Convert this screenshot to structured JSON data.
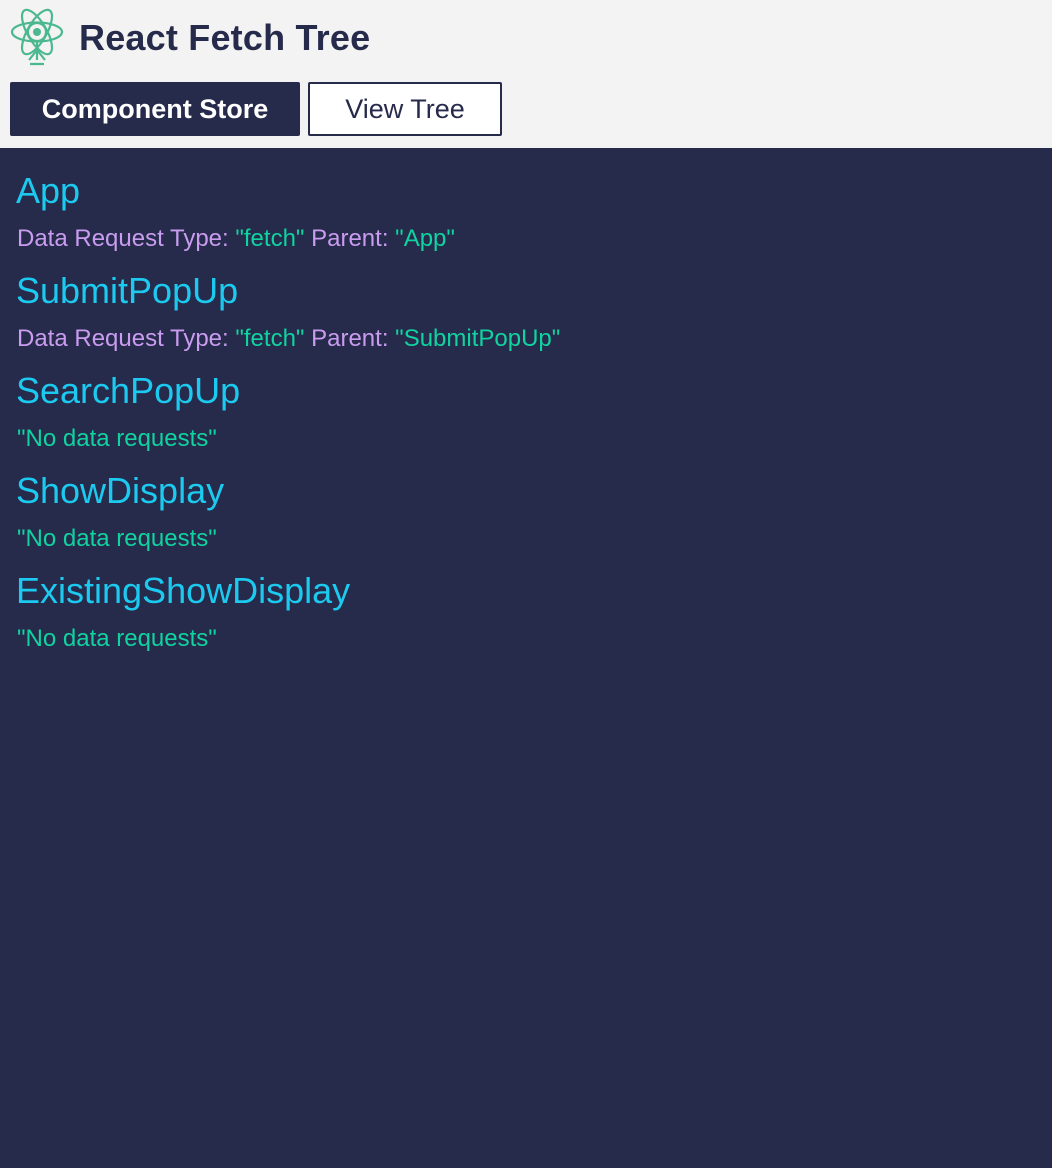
{
  "header": {
    "title": "React Fetch Tree",
    "logo_icon": "react-atom-icon",
    "buttons": {
      "component_store": "Component Store",
      "view_tree": "View Tree"
    }
  },
  "labels": {
    "data_request_type": "Data Request Type:",
    "parent": "Parent:"
  },
  "tree": {
    "nodes": [
      {
        "name": "App",
        "type": "\"fetch\"",
        "parent": "\"App\""
      },
      {
        "name": "SubmitPopUp",
        "type": "\"fetch\"",
        "parent": "\"SubmitPopUp\""
      },
      {
        "name": "SearchPopUp",
        "no_requests": "\"No data requests\""
      },
      {
        "name": "ShowDisplay",
        "no_requests": "\"No data requests\""
      },
      {
        "name": "ExistingShowDisplay",
        "no_requests": "\"No data requests\""
      }
    ]
  },
  "colors": {
    "header_bg": "#f3f3f3",
    "navy": "#262a4b",
    "component_name": "#1ccaf0",
    "label_purple": "#c99cf0",
    "value_green": "#10d3a0",
    "logo_green": "#4cb890"
  }
}
